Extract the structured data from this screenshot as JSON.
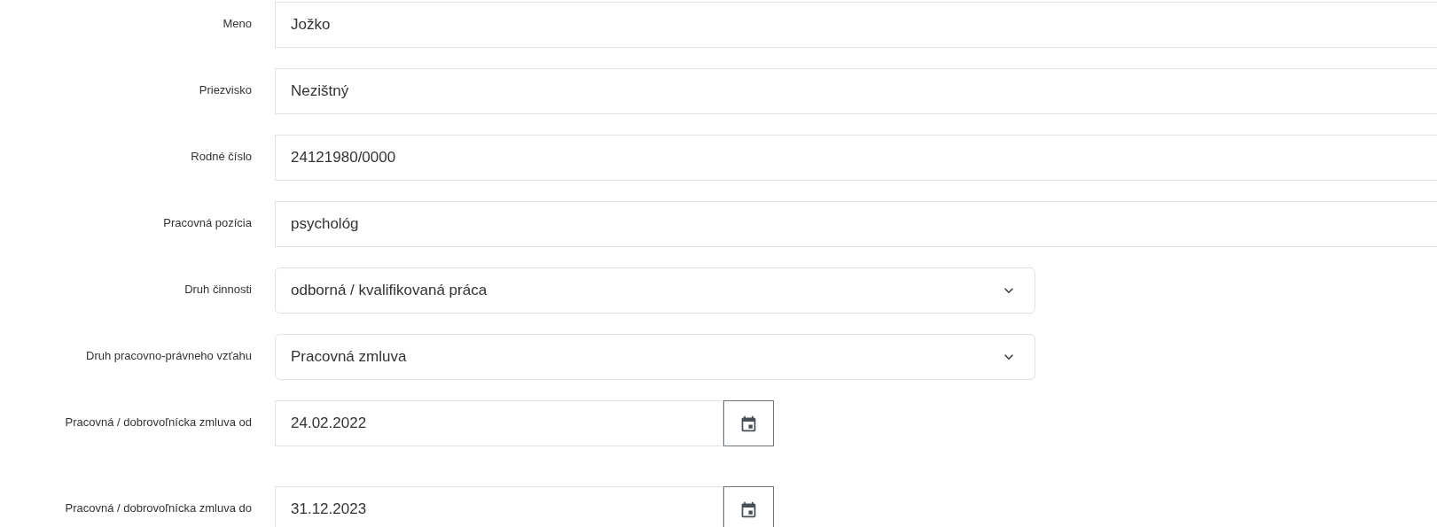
{
  "fields": [
    {
      "kind": "text",
      "label": "Meno",
      "value": "Jožko"
    },
    {
      "kind": "text",
      "label": "Priezvisko",
      "value": "Nezištný"
    },
    {
      "kind": "text",
      "label": "Rodné číslo",
      "value": "24121980/0000"
    },
    {
      "kind": "text",
      "label": "Pracovná pozícia",
      "value": "psychológ"
    },
    {
      "kind": "select",
      "label": "Druh činnosti",
      "value": "odborná / kvalifikovaná práca"
    },
    {
      "kind": "select",
      "label": "Druh pracovno-právneho vzťahu",
      "value": "Pracovná zmluva"
    },
    {
      "kind": "date",
      "label": "Pracovná / dobrovoľnícka zmluva od",
      "value": "24.02.2022"
    },
    {
      "kind": "date",
      "label": "Pracovná / dobrovoľnícka zmluva do",
      "value": "31.12.2023"
    }
  ]
}
